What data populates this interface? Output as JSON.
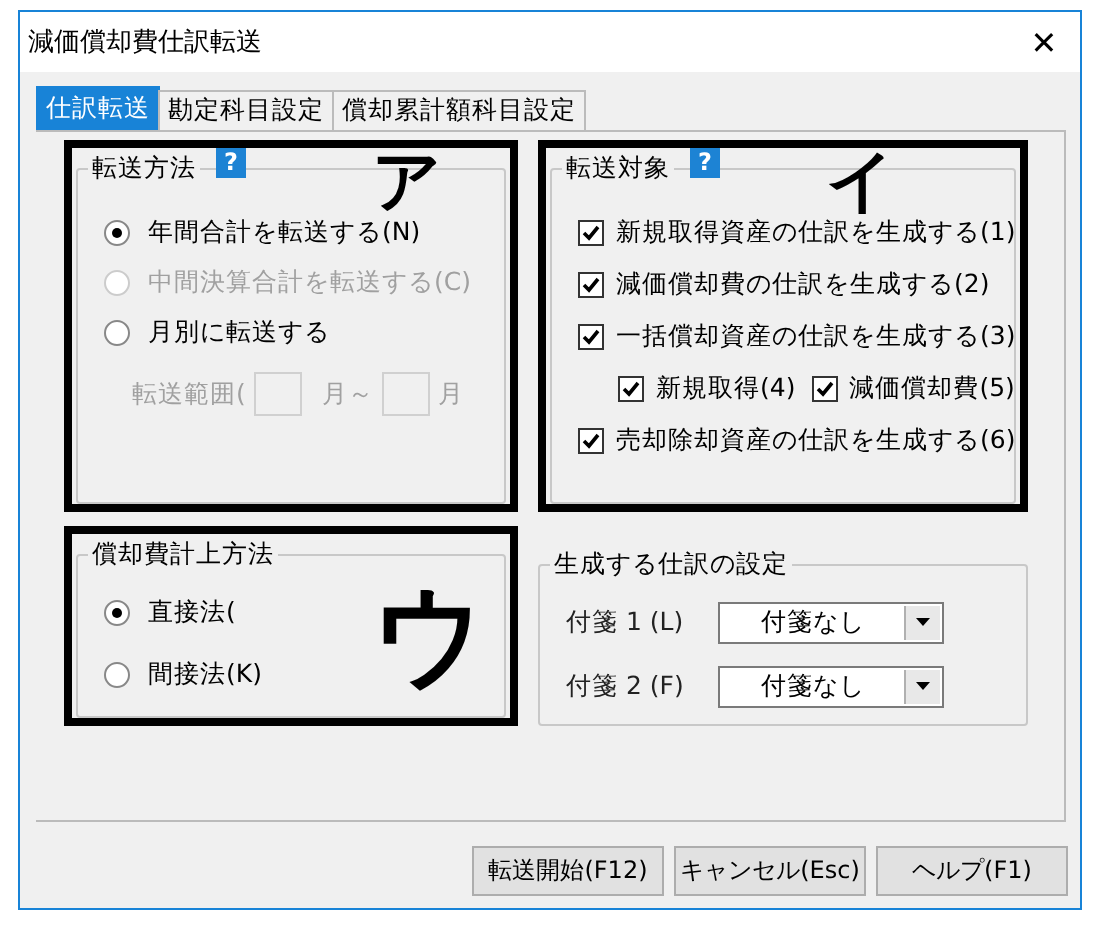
{
  "window": {
    "title": "減価償却費仕訳転送",
    "close": "✕"
  },
  "tabs": [
    {
      "label": "仕訳転送",
      "selected": true
    },
    {
      "label": "勘定科目設定",
      "selected": false
    },
    {
      "label": "償却累計額科目設定",
      "selected": false
    }
  ],
  "transfer_method": {
    "title": "転送方法",
    "help": "?",
    "callout": "ア",
    "options": [
      {
        "label": "年間合計を転送する(N)",
        "selected": true,
        "disabled": false
      },
      {
        "label": "中間決算合計を転送する(C)",
        "selected": false,
        "disabled": true
      },
      {
        "label": "月別に転送する",
        "selected": false,
        "disabled": false
      }
    ],
    "range": {
      "label": "転送範囲(",
      "middle": "月～",
      "end": "月",
      "disabled": true
    }
  },
  "transfer_target": {
    "title": "転送対象",
    "help": "?",
    "callout": "イ",
    "items": [
      {
        "label": "新規取得資産の仕訳を生成する(1)",
        "checked": true
      },
      {
        "label": "減価償却費の仕訳を生成する(2)",
        "checked": true
      },
      {
        "label": "一括償却資産の仕訳を生成する(3)",
        "checked": true,
        "children": [
          {
            "label": "新規取得(4)",
            "checked": true
          },
          {
            "label": "減価償却費(5)",
            "checked": true
          }
        ]
      },
      {
        "label": "売却除却資産の仕訳を生成する(6)",
        "checked": true
      }
    ]
  },
  "posting_method": {
    "title": "償却費計上方法",
    "callout": "ウ",
    "options": [
      {
        "label": "直接法(",
        "selected": true
      },
      {
        "label": "間接法(K)",
        "selected": false
      }
    ]
  },
  "journal_settings": {
    "title": "生成する仕訳の設定",
    "fields": [
      {
        "label": "付箋 1 (L)",
        "value": "付箋なし"
      },
      {
        "label": "付箋 2 (F)",
        "value": "付箋なし"
      }
    ]
  },
  "buttons": [
    "転送開始(F12)",
    "キャンセル(Esc)",
    "ヘルプ(F1)"
  ]
}
